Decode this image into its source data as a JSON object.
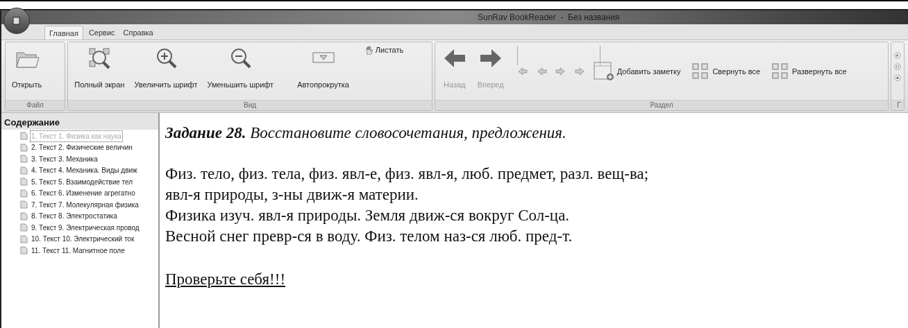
{
  "window": {
    "title": "SunRav BookReader  -  Без названия"
  },
  "tabs": [
    {
      "label": "Главная",
      "selected": true
    },
    {
      "label": "Сервис",
      "selected": false
    },
    {
      "label": "Справка",
      "selected": false
    }
  ],
  "ribbon": {
    "groups": [
      {
        "label": "Файл",
        "buttons": [
          {
            "label": "Открыть",
            "disabled": false
          }
        ]
      },
      {
        "label": "Вид",
        "buttons": [
          {
            "label": "Полный экран",
            "disabled": false
          },
          {
            "label": "Увеличить шрифт",
            "disabled": false
          },
          {
            "label": "Уменьшить шрифт",
            "disabled": false
          },
          {
            "label": "Автопрокрутка",
            "disabled": false
          }
        ],
        "small": [
          {
            "label": "Листать"
          }
        ]
      },
      {
        "label": "Раздел",
        "buttons": [
          {
            "label": "Назад",
            "disabled": true
          },
          {
            "label": "Вперед",
            "disabled": true
          }
        ],
        "note": "Добавить заметку",
        "collapse": "Свернуть все",
        "expand": "Развернуть все"
      },
      {
        "label": "Г"
      }
    ]
  },
  "sidebar": {
    "title": "Содержание",
    "items": [
      {
        "label": "1. Текст 1. Физика как наука",
        "selected": true
      },
      {
        "label": "2. Текст 2. Физические величин",
        "selected": false
      },
      {
        "label": "3. Текст 3. Механика",
        "selected": false
      },
      {
        "label": "4. Текст 4. Механика. Виды движ",
        "selected": false
      },
      {
        "label": "5. Текст 5. Взаимодействие тел",
        "selected": false
      },
      {
        "label": "6. Текст 6. Изменение агрегатно",
        "selected": false
      },
      {
        "label": "7. Текст 7. Молекулярная физика",
        "selected": false
      },
      {
        "label": "8. Текст 8. Электростатика",
        "selected": false
      },
      {
        "label": "9. Текст 9. Электрическая провод",
        "selected": false
      },
      {
        "label": "10. Текст 10. Электрический ток",
        "selected": false
      },
      {
        "label": "11. Текст 11. Магнитное поле",
        "selected": false
      }
    ]
  },
  "document": {
    "heading": "**Задание 28.** Восстановите словосочетания, предложения.",
    "lines": [
      "Физ. тело, физ. тела, физ. явл-е, физ. явл-я, люб. предмет, разл. вещ-ва;",
      "явл-я природы, з-ны движ-я материи.",
      "Физика изуч. явл-я природы. Земля движ-ся вокруг Сол-ца.",
      "Весной снег превр-ся в воду. Физ. телом наз-ся люб. пред-т."
    ],
    "link": "Проверьте себя!!!"
  }
}
